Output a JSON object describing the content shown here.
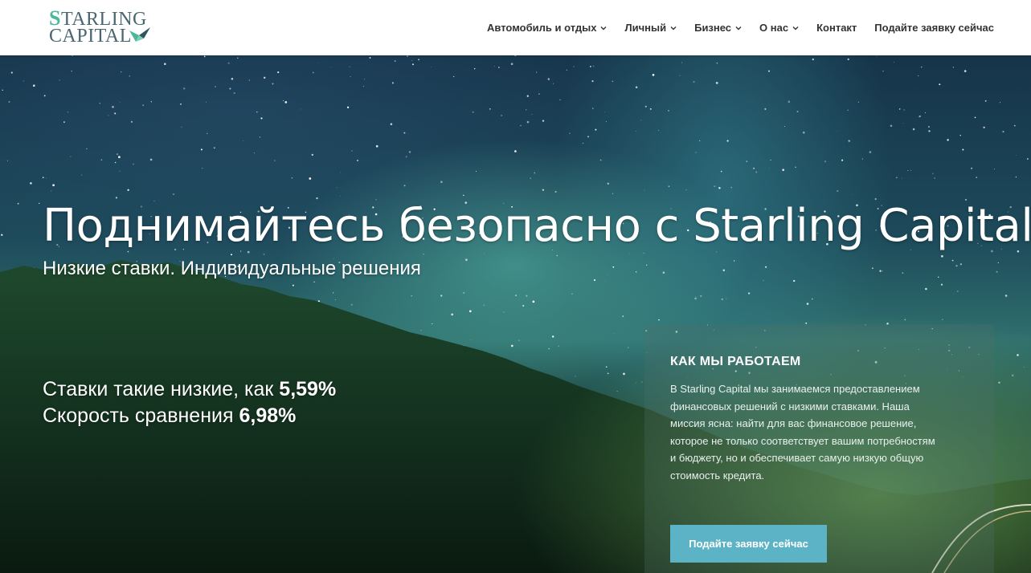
{
  "logo": {
    "line1_initial": "S",
    "line1_rest": "TARLING",
    "line2": "CAPITAL",
    "icon": "bird-logo-icon"
  },
  "nav": {
    "items": [
      {
        "label": "Автомобиль и отдых",
        "has_dropdown": true
      },
      {
        "label": "Личный",
        "has_dropdown": true
      },
      {
        "label": "Бизнес",
        "has_dropdown": true
      },
      {
        "label": "О нас",
        "has_dropdown": true
      },
      {
        "label": "Контакт",
        "has_dropdown": false
      },
      {
        "label": "Подайте заявку сейчас",
        "has_dropdown": false
      }
    ]
  },
  "hero": {
    "title": "Поднимайтесь безопасно с Starling Capital.",
    "subtitle": "Низкие ставки. Индивидуальные решения",
    "rate_line1_prefix": "Ставки такие низкие, как ",
    "rate_line1_value": "5,59%",
    "rate_line2_prefix": "Скорость сравнения ",
    "rate_line2_value": "6,98%"
  },
  "how": {
    "title": "КАК МЫ РАБОТАЕМ",
    "text": "В Starling Capital мы занимаемся предоставлением финансовых решений с низкими ставками. Наша миссия ясна: найти для вас финансовое решение, которое не только соответствует вашим потребностям и бюджету, но и обеспечивает самую низкую общую стоимость кредита.",
    "button_label": "Подайте заявку сейчас"
  },
  "colors": {
    "accent_button": "#5db3c6",
    "logo_teal": "#4bb79a",
    "logo_slate": "#4a6670",
    "nav_text": "#333333"
  }
}
